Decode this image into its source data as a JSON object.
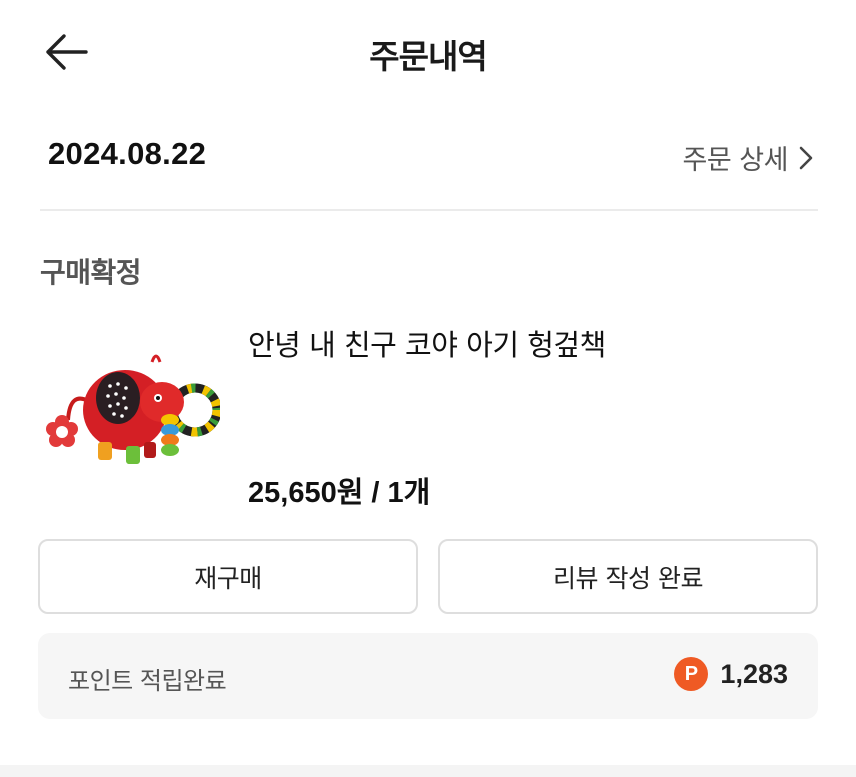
{
  "header": {
    "title": "주문내역",
    "back_icon": "arrow-left-icon"
  },
  "order": {
    "date": "2024.08.22",
    "detail_link_label": "주문 상세",
    "detail_icon": "chevron-right-icon"
  },
  "status": "구매확정",
  "product": {
    "name": "안녕 내 친구 코야 아기 헝겊책",
    "price": "25,650원 / 1개",
    "image": "red-elephant-cloth-book-image"
  },
  "actions": {
    "rebuy_label": "재구매",
    "review_label": "리뷰 작성 완료"
  },
  "points": {
    "label": "포인트 적립완료",
    "icon_letter": "P",
    "value": "1,283",
    "icon_color": "#ef5a24"
  }
}
